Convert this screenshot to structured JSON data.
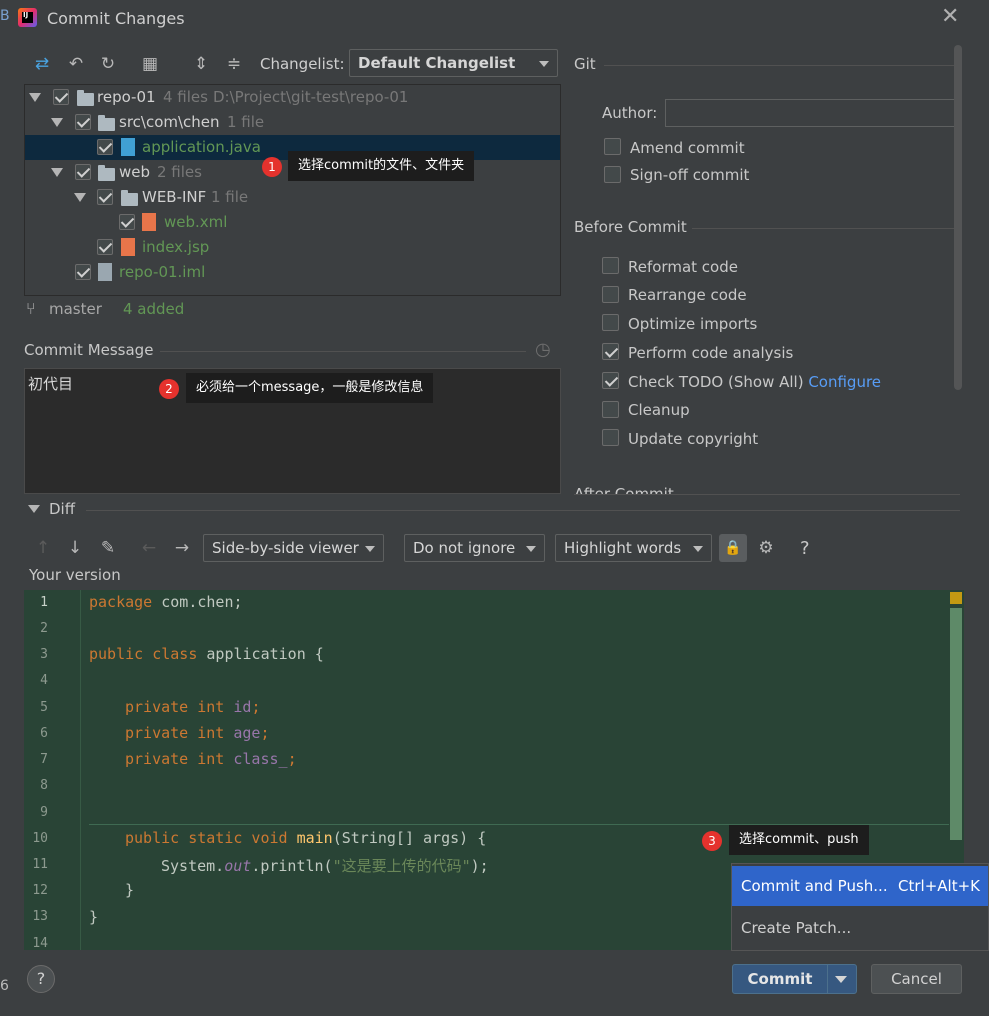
{
  "window": {
    "title": "Commit Changes"
  },
  "toolbar": {
    "changelist_label": "Changelist:",
    "changelist_value": "Default Changelist"
  },
  "tree": {
    "rows": [
      {
        "name": "repo-01",
        "meta": "4 files",
        "path": "D:\\Project\\git-test\\repo-01"
      },
      {
        "name": "src\\com\\chen",
        "meta": "1 file"
      },
      {
        "name": "application.java"
      },
      {
        "name": "web",
        "meta": "2 files"
      },
      {
        "name": "WEB-INF",
        "meta": "1 file"
      },
      {
        "name": "web.xml"
      },
      {
        "name": "index.jsp"
      },
      {
        "name": "repo-01.iml"
      }
    ]
  },
  "branch": {
    "name": "master",
    "status": "4 added"
  },
  "commit_message": {
    "label": "Commit Message",
    "value": "初代目"
  },
  "callouts": {
    "one": {
      "num": "1",
      "text": "选择commit的文件、文件夹"
    },
    "two": {
      "num": "2",
      "text": "必须给一个message，一般是修改信息"
    },
    "three": {
      "num": "3",
      "text": "选择commit、push"
    }
  },
  "git_panel": {
    "title": "Git",
    "author_label": "Author:",
    "author_value": "",
    "amend": "Amend commit",
    "signoff": "Sign-off commit",
    "before_commit_title": "Before Commit",
    "options": [
      {
        "label": "Reformat code",
        "checked": false
      },
      {
        "label": "Rearrange code",
        "checked": false
      },
      {
        "label": "Optimize imports",
        "checked": false
      },
      {
        "label": "Perform code analysis",
        "checked": true
      },
      {
        "label": "Check TODO (Show All)",
        "checked": true,
        "link": "Configure"
      },
      {
        "label": "Cleanup",
        "checked": false
      },
      {
        "label": "Update copyright",
        "checked": false
      }
    ],
    "after_commit_title": "After Commit"
  },
  "diff": {
    "title": "Diff",
    "viewer": "Side-by-side viewer",
    "ignore": "Do not ignore",
    "highlight": "Highlight words",
    "help": "?",
    "your_version": "Your version"
  },
  "code": {
    "line_numbers": [
      "1",
      "2",
      "3",
      "4",
      "5",
      "6",
      "7",
      "8",
      "9",
      "10",
      "11",
      "12",
      "13",
      "14"
    ],
    "l1_kw": "package",
    "l1_rest": " com.chen;",
    "l3_kw1": "public",
    "l3_kw2": " class",
    "l3_rest": " application {",
    "l5_kw": "private int",
    "l5_fld": " id",
    "l5_end": ";",
    "l6_kw": "private int",
    "l6_fld": " age",
    "l6_end": ";",
    "l7_kw": "private int",
    "l7_fld": " class_",
    "l7_end": ";",
    "l10_kw": "public static void",
    "l10_fn": " main",
    "l10_rest": "(String[] args) {",
    "l11_a": "System.",
    "l11_stat": "out",
    "l11_b": ".println(",
    "l11_str": "\"这是要上传的代码\"",
    "l11_c": ");",
    "l12": "}",
    "l13": "}"
  },
  "popup": {
    "commit_push": "Commit and Push...",
    "commit_push_shortcut": "Ctrl+Alt+K",
    "create_patch": "Create Patch..."
  },
  "footer": {
    "help": "?",
    "commit": "Commit",
    "cancel": "Cancel"
  },
  "edge_text": {
    "left_b": "B",
    "left_6": "6"
  },
  "colors": {
    "background": "#3c3f41",
    "selection": "#2f65ca",
    "primary_button": "#365880",
    "diff_added": "#294436",
    "callout_badge": "#e5322d"
  }
}
